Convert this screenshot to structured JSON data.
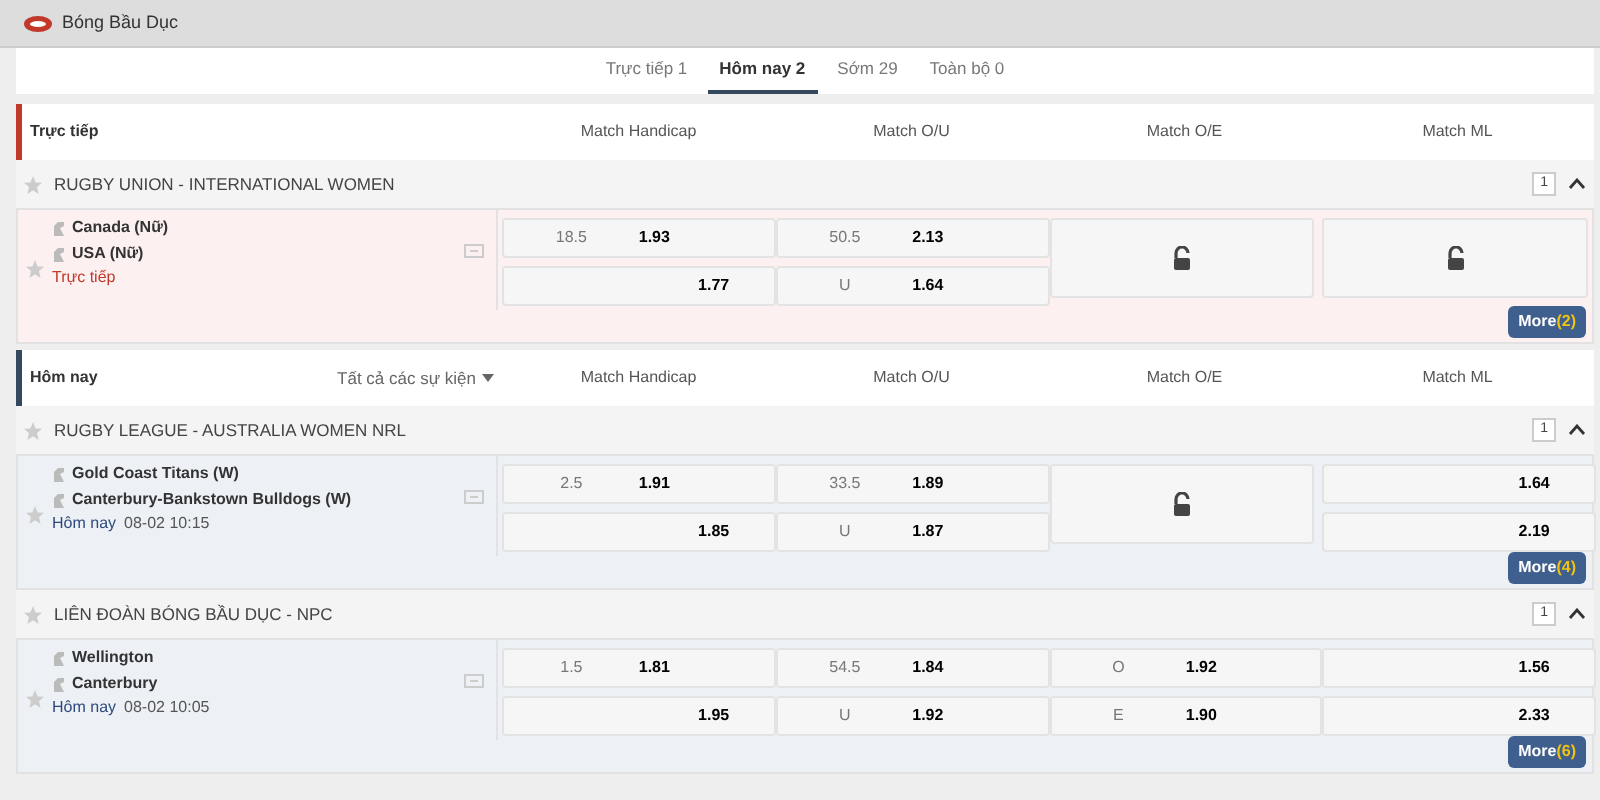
{
  "sport": {
    "title": "Bóng Bầu Dục"
  },
  "tabs": [
    {
      "label": "Trực tiếp 1",
      "selected": false
    },
    {
      "label": "Hôm nay 2",
      "selected": true
    },
    {
      "label": "Sớm 29",
      "selected": false
    },
    {
      "label": "Toàn bộ 0",
      "selected": false
    }
  ],
  "sections": [
    {
      "label": "Trực tiếp",
      "kind": "live",
      "market_columns": [
        "Match Handicap",
        "Match O/U",
        "Match O/E",
        "Match ML"
      ],
      "leagues": [
        {
          "name": "RUGBY UNION - INTERNATIONAL WOMEN",
          "count": "1",
          "expanded": true,
          "matches": [
            {
              "home": "Canada (Nữ)",
              "away": "USA (Nữ)",
              "status": "Trực tiếp",
              "more": {
                "label": "More",
                "count": "(2)"
              },
              "markets": [
                {
                  "kind": "odds",
                  "rows": [
                    {
                      "line": "18.5",
                      "odds": "1.93"
                    },
                    {
                      "odds": "1.77"
                    }
                  ]
                },
                {
                  "kind": "odds",
                  "rows": [
                    {
                      "line": "50.5",
                      "odds": "2.13"
                    },
                    {
                      "line": "U",
                      "odds": "1.64"
                    }
                  ]
                },
                {
                  "kind": "locked"
                },
                {
                  "kind": "locked"
                }
              ]
            }
          ]
        }
      ]
    },
    {
      "label": "Hôm nay",
      "kind": "today",
      "filter": "Tất cả các sự kiện",
      "market_columns": [
        "Match Handicap",
        "Match O/U",
        "Match O/E",
        "Match ML"
      ],
      "leagues": [
        {
          "name": "RUGBY LEAGUE - AUSTRALIA WOMEN NRL",
          "count": "1",
          "expanded": true,
          "matches": [
            {
              "home": "Gold Coast Titans (W)",
              "away": "Canterbury-Bankstown Bulldogs (W)",
              "status": "Hôm nay",
              "time": "08-02 10:15",
              "more": {
                "label": "More",
                "count": "(4)"
              },
              "markets": [
                {
                  "kind": "odds",
                  "rows": [
                    {
                      "line": "2.5",
                      "odds": "1.91"
                    },
                    {
                      "odds": "1.85"
                    }
                  ]
                },
                {
                  "kind": "odds",
                  "rows": [
                    {
                      "line": "33.5",
                      "odds": "1.89"
                    },
                    {
                      "line": "U",
                      "odds": "1.87"
                    }
                  ]
                },
                {
                  "kind": "locked"
                },
                {
                  "kind": "odds",
                  "rows": [
                    {
                      "odds": "1.64"
                    },
                    {
                      "odds": "2.19"
                    }
                  ]
                }
              ]
            }
          ]
        },
        {
          "name": "LIÊN ĐOÀN BÓNG BẦU DỤC - NPC",
          "count": "1",
          "expanded": true,
          "matches": [
            {
              "home": "Wellington",
              "away": "Canterbury",
              "status": "Hôm nay",
              "time": "08-02 10:05",
              "more": {
                "label": "More",
                "count": "(6)"
              },
              "markets": [
                {
                  "kind": "odds",
                  "rows": [
                    {
                      "line": "1.5",
                      "odds": "1.81"
                    },
                    {
                      "odds": "1.95"
                    }
                  ]
                },
                {
                  "kind": "odds",
                  "rows": [
                    {
                      "line": "54.5",
                      "odds": "1.84"
                    },
                    {
                      "line": "U",
                      "odds": "1.92"
                    }
                  ]
                },
                {
                  "kind": "odds",
                  "rows": [
                    {
                      "line": "O",
                      "odds": "1.92"
                    },
                    {
                      "line": "E",
                      "odds": "1.90"
                    }
                  ]
                },
                {
                  "kind": "odds",
                  "rows": [
                    {
                      "odds": "1.56"
                    },
                    {
                      "odds": "2.33"
                    }
                  ]
                }
              ]
            }
          ]
        }
      ]
    }
  ]
}
